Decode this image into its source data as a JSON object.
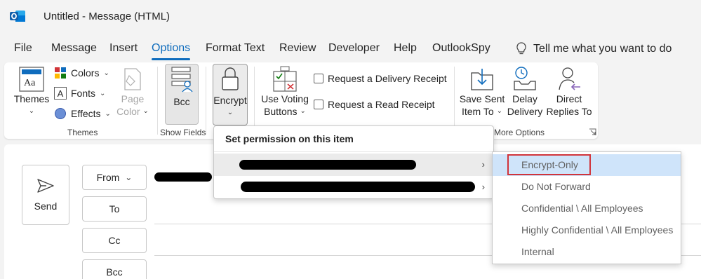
{
  "window": {
    "title": "Untitled  -  Message (HTML)"
  },
  "tabs": [
    {
      "label": "File"
    },
    {
      "label": "Message"
    },
    {
      "label": "Insert"
    },
    {
      "label": "Options"
    },
    {
      "label": "Format Text"
    },
    {
      "label": "Review"
    },
    {
      "label": "Developer"
    },
    {
      "label": "Help"
    },
    {
      "label": "OutlookSpy"
    }
  ],
  "active_tab": "Options",
  "tellme": {
    "placeholder": "Tell me what you want to do"
  },
  "ribbon": {
    "themes": {
      "themes_label": "Themes",
      "colors_label": "Colors",
      "fonts_label": "Fonts",
      "effects_label": "Effects",
      "page_color_label_1": "Page",
      "page_color_label_2": "Color",
      "group_label": "Themes"
    },
    "show_fields": {
      "bcc_label": "Bcc",
      "group_label": "Show Fields"
    },
    "encrypt": {
      "label": "Encrypt"
    },
    "tracking": {
      "voting_label_1": "Use Voting",
      "voting_label_2": "Buttons",
      "delivery_receipt": "Request a Delivery Receipt",
      "read_receipt": "Request a Read Receipt"
    },
    "more_options": {
      "save_sent_1": "Save Sent",
      "save_sent_2": "Item To",
      "delay_1": "Delay",
      "delay_2": "Delivery",
      "direct_1": "Direct",
      "direct_2": "Replies To",
      "group_label": "More Options"
    }
  },
  "compose": {
    "send_label": "Send",
    "from_label": "From",
    "to_label": "To",
    "cc_label": "Cc",
    "bcc_label": "Bcc"
  },
  "encrypt_menu": {
    "header": "Set permission on this item"
  },
  "permission_submenu": {
    "items": [
      {
        "label": "Encrypt-Only"
      },
      {
        "label": "Do Not Forward"
      },
      {
        "label": "Confidential \\ All Employees"
      },
      {
        "label": "Highly Confidential \\ All Employees"
      },
      {
        "label": "Internal"
      }
    ]
  },
  "colors": {
    "accent": "#0f6cbd",
    "highlight": "#d1343b",
    "hover": "#cfe4fa"
  }
}
